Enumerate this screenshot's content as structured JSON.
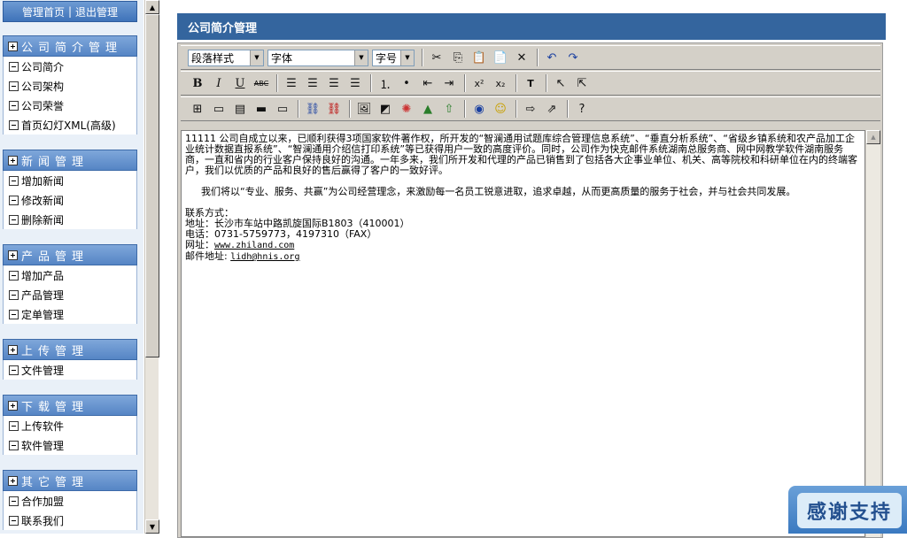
{
  "sidebar": {
    "top_links": {
      "home": "管理首页",
      "separator": "|",
      "logout": "退出管理"
    },
    "groups": [
      {
        "title": "公司简介管理",
        "items": [
          "公司简介",
          "公司架构",
          "公司荣誉",
          "首页幻灯XML(高级)"
        ]
      },
      {
        "title": "新闻管理",
        "items": [
          "增加新闻",
          "修改新闻",
          "删除新闻"
        ]
      },
      {
        "title": "产品管理",
        "items": [
          "增加产品",
          "产品管理",
          "定单管理"
        ]
      },
      {
        "title": "上传管理",
        "items": [
          "文件管理"
        ]
      },
      {
        "title": "下载管理",
        "items": [
          "上传软件",
          "软件管理"
        ]
      },
      {
        "title": "其它管理",
        "items": [
          "合作加盟",
          "联系我们"
        ]
      }
    ]
  },
  "main": {
    "title": "公司简介管理",
    "toolbar": {
      "paragraph_style": "段落样式",
      "font": "字体",
      "font_size": "字号"
    },
    "content": {
      "para1": "11111    公司自成立以来，已顺利获得3项国家软件著作权，所开发的“智澜通用试题库综合管理信息系统”、“垂直分析系统”、“省级乡镇系统和农产品加工企业统计数据直报系统”、“智澜通用介绍信打印系统”等已获得用户一致的高度评价。同时，公司作为快克邮件系统湖南总服务商、网中网教学软件湖南服务商，一直和省内的行业客户保持良好的沟通。一年多来，我们所开发和代理的产品已销售到了包括各大企事业单位、机关、高等院校和科研单位在内的终端客户，我们以优质的产品和良好的售后赢得了客户的一致好评。",
      "para2": "我们将以“专业、服务、共赢”为公司经营理念，来激励每一名员工锐意进取，追求卓越，从而更高质量的服务于社会，并与社会共同发展。",
      "contact_heading": "联系方式：",
      "address": "地址：长沙市车站中路凯旋国际B1803（410001）",
      "phone": "电话：0731-5759773，4197310（FAX）",
      "website_label": "网址：",
      "website": "www.zhiland.com",
      "email_label": "邮件地址: ",
      "email": "lidh@hnis.org"
    }
  },
  "badge": {
    "text": "感谢支持"
  },
  "colors": {
    "header_blue": "#34659e",
    "menu_blue": "#5585c5",
    "editor_gray": "#d4d0c8"
  }
}
